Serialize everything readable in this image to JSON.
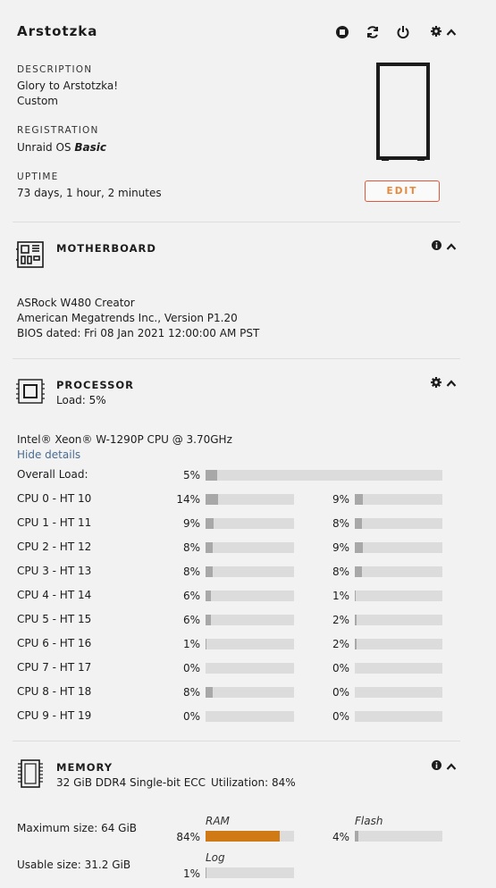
{
  "server": {
    "name": "Arstotzka",
    "description_label": "DESCRIPTION",
    "description_line1": "Glory to Arstotzka!",
    "description_line2": "Custom",
    "registration_label": "REGISTRATION",
    "registration_prefix": "Unraid OS ",
    "registration_tier": "Basic",
    "uptime_label": "UPTIME",
    "uptime_value": "73 days, 1 hour, 2 minutes",
    "edit_label": "EDIT"
  },
  "motherboard": {
    "header": "MOTHERBOARD",
    "model": "ASRock W480 Creator",
    "bios_vendor": "American Megatrends Inc., Version P1.20",
    "bios_date": "BIOS dated: Fri 08 Jan 2021 12:00:00 AM PST"
  },
  "processor": {
    "header": "PROCESSOR",
    "load_summary": "Load: 5%",
    "model": "Intel® Xeon® W-1290P CPU @ 3.70GHz",
    "hide_details": "Hide details",
    "overall_label": "Overall Load:",
    "overall_pct": "5%",
    "overall_value": 5,
    "cpus": [
      {
        "name": "CPU 0 - HT 10",
        "a_pct": "14%",
        "a": 14,
        "b_pct": "9%",
        "b": 9
      },
      {
        "name": "CPU 1 - HT 11",
        "a_pct": "9%",
        "a": 9,
        "b_pct": "8%",
        "b": 8
      },
      {
        "name": "CPU 2 - HT 12",
        "a_pct": "8%",
        "a": 8,
        "b_pct": "9%",
        "b": 9
      },
      {
        "name": "CPU 3 - HT 13",
        "a_pct": "8%",
        "a": 8,
        "b_pct": "8%",
        "b": 8
      },
      {
        "name": "CPU 4 - HT 14",
        "a_pct": "6%",
        "a": 6,
        "b_pct": "1%",
        "b": 1
      },
      {
        "name": "CPU 5 - HT 15",
        "a_pct": "6%",
        "a": 6,
        "b_pct": "2%",
        "b": 2
      },
      {
        "name": "CPU 6 - HT 16",
        "a_pct": "1%",
        "a": 1,
        "b_pct": "2%",
        "b": 2
      },
      {
        "name": "CPU 7 - HT 17",
        "a_pct": "0%",
        "a": 0,
        "b_pct": "0%",
        "b": 0
      },
      {
        "name": "CPU 8 - HT 18",
        "a_pct": "8%",
        "a": 8,
        "b_pct": "0%",
        "b": 0
      },
      {
        "name": "CPU 9 - HT 19",
        "a_pct": "0%",
        "a": 0,
        "b_pct": "0%",
        "b": 0
      }
    ]
  },
  "memory": {
    "header": "MEMORY",
    "spec": "32 GiB DDR4 Single-bit ECC",
    "utilization": "Utilization: 84%",
    "max_size": "Maximum size: 64 GiB",
    "usable_size": "Usable size: 31.2 GiB",
    "ram_label": "RAM",
    "ram_pct": "84%",
    "ram_value": 84,
    "flash_label": "Flash",
    "flash_pct": "4%",
    "flash_value": 4,
    "log_label": "Log",
    "log_pct": "1%",
    "log_value": 1
  },
  "colors": {
    "accent_orange": "#d07a15",
    "bar_fill": "#a8a8a8",
    "bar_track": "#dcdcdc",
    "edit_border": "#e0573a"
  },
  "icons": [
    "stop-icon",
    "refresh-icon",
    "power-icon",
    "gear-icon",
    "chevron-up-icon",
    "info-icon",
    "server-case-icon",
    "motherboard-icon",
    "processor-icon",
    "memory-icon"
  ]
}
